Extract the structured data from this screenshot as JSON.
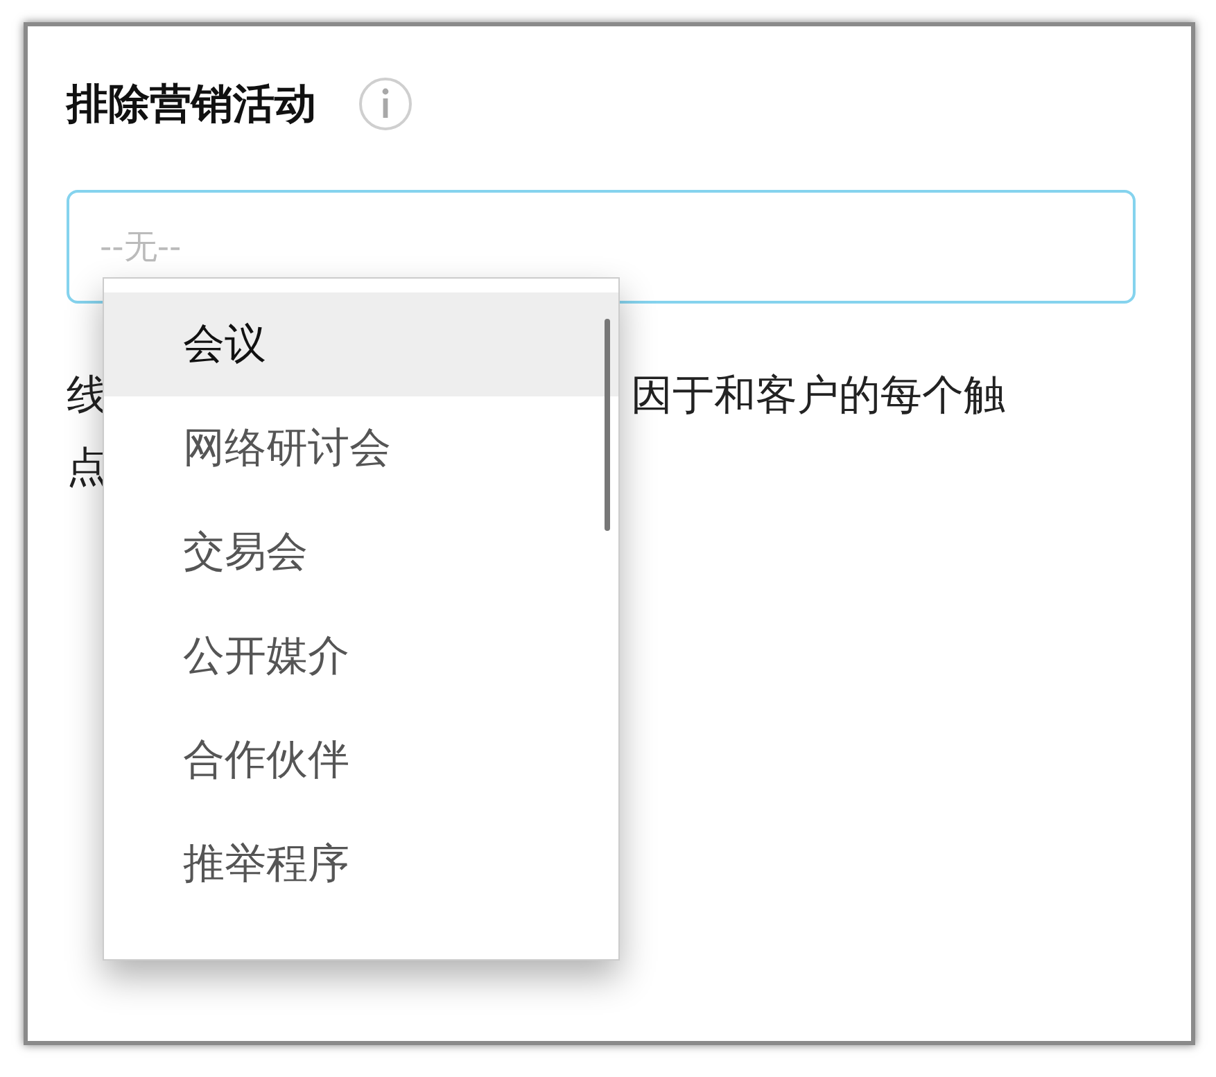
{
  "title": "排除营销活动",
  "field": {
    "placeholder": "--无--"
  },
  "description": {
    "line_1_start": "线",
    "line_1_end": "因于和客户的每个触",
    "line_2_start": "点"
  },
  "dropdown": {
    "items": [
      {
        "label": "会议",
        "selected": true
      },
      {
        "label": "网络研讨会",
        "selected": false
      },
      {
        "label": "交易会",
        "selected": false
      },
      {
        "label": "公开媒介",
        "selected": false
      },
      {
        "label": "合作伙伴",
        "selected": false
      },
      {
        "label": "推举程序",
        "selected": false
      }
    ]
  }
}
